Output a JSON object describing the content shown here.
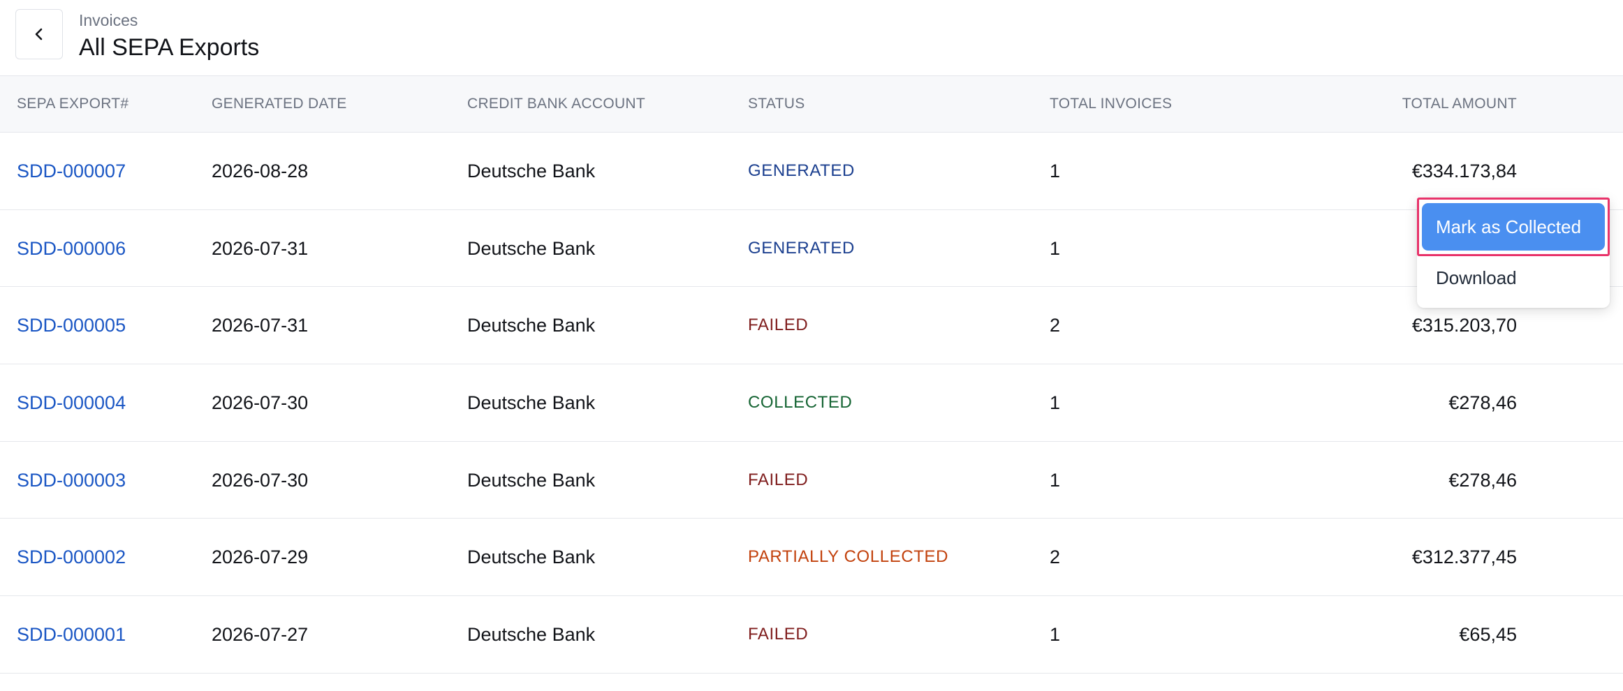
{
  "header": {
    "breadcrumb": "Invoices",
    "title": "All SEPA Exports",
    "back_icon": "chevron-left-icon"
  },
  "table": {
    "columns": [
      "SEPA EXPORT#",
      "GENERATED DATE",
      "CREDIT BANK ACCOUNT",
      "STATUS",
      "TOTAL INVOICES",
      "TOTAL AMOUNT"
    ],
    "rows": [
      {
        "id": "SDD-000007",
        "date": "2026-08-28",
        "bank": "Deutsche Bank",
        "status": "GENERATED",
        "invoices": "1",
        "amount": "€334.173,84"
      },
      {
        "id": "SDD-000006",
        "date": "2026-07-31",
        "bank": "Deutsche Bank",
        "status": "GENERATED",
        "invoices": "1",
        "amount": "€"
      },
      {
        "id": "SDD-000005",
        "date": "2026-07-31",
        "bank": "Deutsche Bank",
        "status": "FAILED",
        "invoices": "2",
        "amount": "€315.203,70"
      },
      {
        "id": "SDD-000004",
        "date": "2026-07-30",
        "bank": "Deutsche Bank",
        "status": "COLLECTED",
        "invoices": "1",
        "amount": "€278,46"
      },
      {
        "id": "SDD-000003",
        "date": "2026-07-30",
        "bank": "Deutsche Bank",
        "status": "FAILED",
        "invoices": "1",
        "amount": "€278,46"
      },
      {
        "id": "SDD-000002",
        "date": "2026-07-29",
        "bank": "Deutsche Bank",
        "status": "PARTIALLY COLLECTED",
        "invoices": "2",
        "amount": "€312.377,45"
      },
      {
        "id": "SDD-000001",
        "date": "2026-07-27",
        "bank": "Deutsche Bank",
        "status": "FAILED",
        "invoices": "1",
        "amount": "€65,45"
      }
    ]
  },
  "status_colors": {
    "GENERATED": "#1b3f8f",
    "FAILED": "#7f1d1d",
    "COLLECTED": "#166534",
    "PARTIALLY COLLECTED": "#c2410c"
  },
  "link_color": "#1a56c4",
  "context_menu": {
    "primary_label": "Mark as Collected",
    "secondary_label": "Download",
    "primary_color": "#4a8ff0",
    "highlight_color": "#e8336a"
  }
}
